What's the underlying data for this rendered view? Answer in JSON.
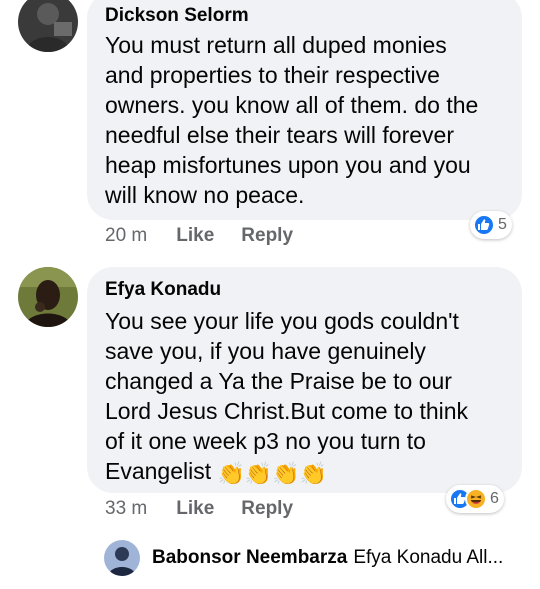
{
  "comments": [
    {
      "author": "Dickson Selorm",
      "text": "You must return all duped monies\nand properties to their respective\nowners. you know all of them. do the\nneedful else their tears will forever\nheap misfortunes upon you and you\nwill know no peace.",
      "time": "20 m",
      "like_label": "Like",
      "reply_label": "Reply",
      "reaction_count": "5",
      "reaction_icons": [
        "like-icon"
      ]
    },
    {
      "author": "Efya Konadu",
      "text": "You see your life you gods couldn't\nsave you, if you have genuinely\nchanged a Ya the Praise be to our\nLord Jesus Christ.But come to think\nof it one week p3 no you turn to\nEvangelist ",
      "emojis": "👏👏👏👏",
      "time": "33 m",
      "like_label": "Like",
      "reply_label": "Reply",
      "reaction_count": "6",
      "reaction_icons": [
        "like-icon",
        "haha-icon"
      ]
    }
  ],
  "reply_preview": {
    "author": "Babonsor Neembarza",
    "snippet": "Efya Konadu All..."
  },
  "colors": {
    "bubble": "#f0f2f5",
    "meta": "#65676b",
    "like_blue": "#1877f2",
    "haha_yellow": "#f7b125"
  }
}
